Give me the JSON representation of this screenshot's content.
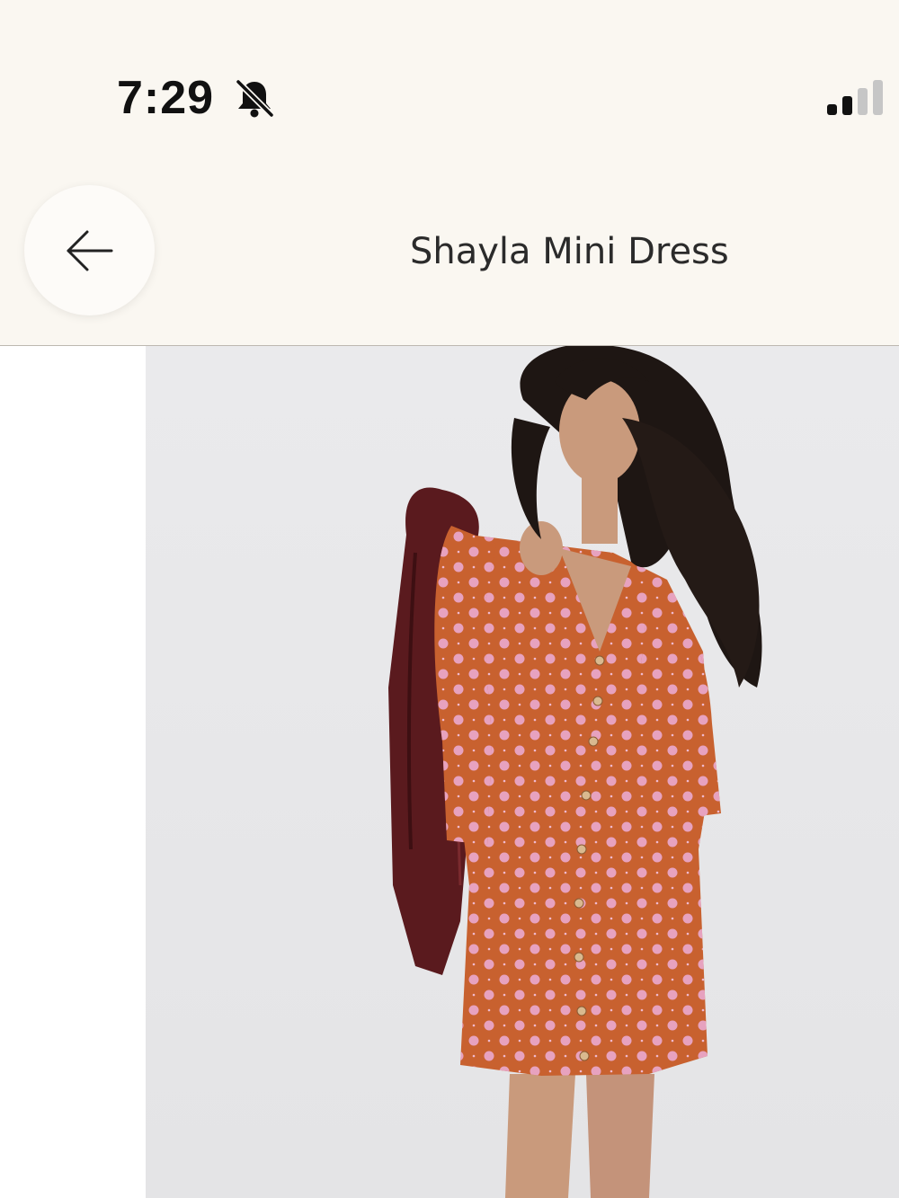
{
  "status_bar": {
    "time": "7:29",
    "mute_icon": "bell-slash-icon",
    "signal_icon": "cellular-signal-icon",
    "signal_level": 0.5
  },
  "header": {
    "back_icon": "arrow-left-icon",
    "title": "Shayla Mini Dress"
  },
  "product": {
    "image_icon": "product-photo",
    "colors": {
      "dress": "#c8612f",
      "dots": "#e7a2bf",
      "jacket": "#5a1a1e",
      "background": "#e9e9eb",
      "header_bg": "#faf7f1"
    }
  }
}
